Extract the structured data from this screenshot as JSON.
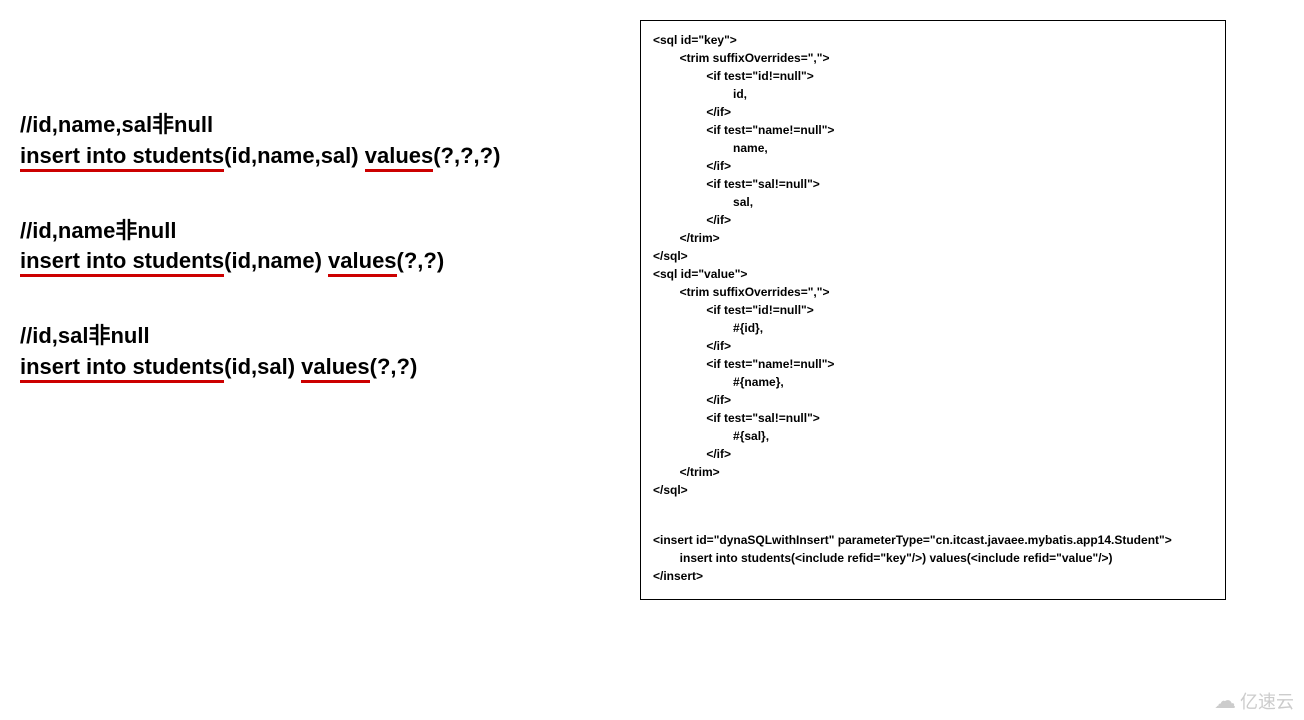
{
  "left": {
    "groups": [
      {
        "comment": "//id,name,sal非null",
        "parts": [
          "insert into students",
          "(id,name,sal)",
          " ",
          "values",
          "(?,?,?)"
        ]
      },
      {
        "comment": "//id,name非null",
        "parts": [
          "insert into students",
          "(id,name)",
          " ",
          "values",
          "(?,?)"
        ]
      },
      {
        "comment": "//id,sal非null",
        "parts": [
          "insert into students",
          "(id,sal)",
          " ",
          "values",
          "(?,?)"
        ]
      }
    ]
  },
  "right": {
    "lines": [
      "<sql id=\"key\">",
      "        <trim suffixOverrides=\",\">",
      "                <if test=\"id!=null\">",
      "                        id,",
      "                </if>",
      "                <if test=\"name!=null\">",
      "                        name,",
      "                </if>",
      "                <if test=\"sal!=null\">",
      "                        sal,",
      "                </if>",
      "        </trim>",
      "</sql>",
      "<sql id=\"value\">",
      "        <trim suffixOverrides=\",\">",
      "                <if test=\"id!=null\">",
      "                        #{id},",
      "                </if>",
      "                <if test=\"name!=null\">",
      "                        #{name},",
      "                </if>",
      "                <if test=\"sal!=null\">",
      "                        #{sal},",
      "                </if>",
      "        </trim>",
      "</sql>",
      "",
      "",
      "<insert id=\"dynaSQLwithInsert\" parameterType=\"cn.itcast.javaee.mybatis.app14.Student\">",
      "        insert into students(<include refid=\"key\"/>) values(<include refid=\"value\"/>)",
      "</insert>"
    ]
  },
  "watermark": "亿速云"
}
